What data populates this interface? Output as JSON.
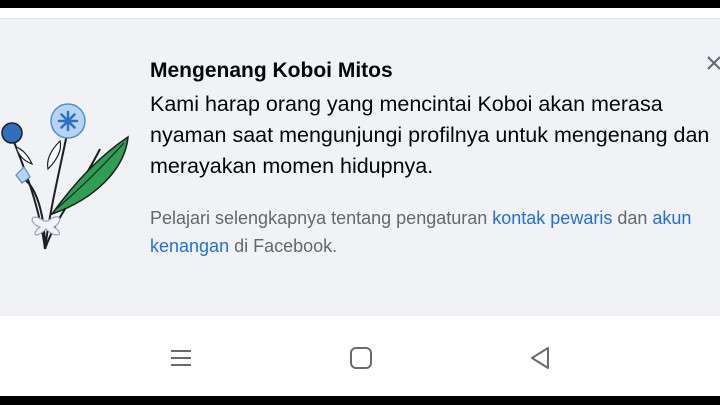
{
  "memorial": {
    "title": "Mengenang Koboi Mitos",
    "message": "Kami harap orang yang mencintai Koboi akan merasa nyaman saat mengunjungi profilnya untuk mengenang dan merayakan momen hidupnya.",
    "footer": {
      "prefix": "Pelajari selengkapnya tentang pengaturan ",
      "link_legacy_contact": "kontak pewaris",
      "middle": " dan ",
      "link_memorial_account": "akun kenangan",
      "suffix": " di Facebook."
    }
  },
  "icons": {
    "illustration": "flower-bouquet-icon",
    "close": "close-icon",
    "nav_recents": "menu-lines-icon",
    "nav_home": "square-home-icon",
    "nav_back": "triangle-back-icon"
  },
  "colors": {
    "card_bg": "#f0f2f5",
    "link": "#216fdb",
    "muted_text": "#65676b",
    "leaf": "#2e9e52",
    "flower_blue": "#4a90d9"
  }
}
